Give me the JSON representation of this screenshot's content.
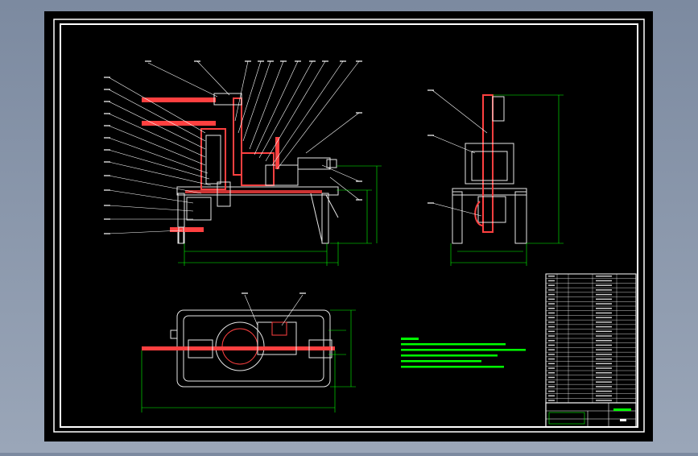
{
  "colors": {
    "background": "#8c98ab",
    "sheet": "#000000",
    "border": "#ffffff",
    "dimension": "#00ff00",
    "hatch": "#ff4040",
    "part_fill": "#e6e6e6",
    "leader": "#ffffff",
    "notes": "#00ff00"
  },
  "sheet": {
    "title_label": "",
    "scale_label": ""
  },
  "views": {
    "front": {
      "balloon_count_left": 12,
      "balloon_count_top": 11,
      "balloon_count_right": 2
    },
    "side": {
      "balloon_count": 3
    },
    "top": {
      "balloon_count": 2
    }
  },
  "title_block": {
    "parts_list_rows": 28,
    "parts_list_cols": 5
  }
}
